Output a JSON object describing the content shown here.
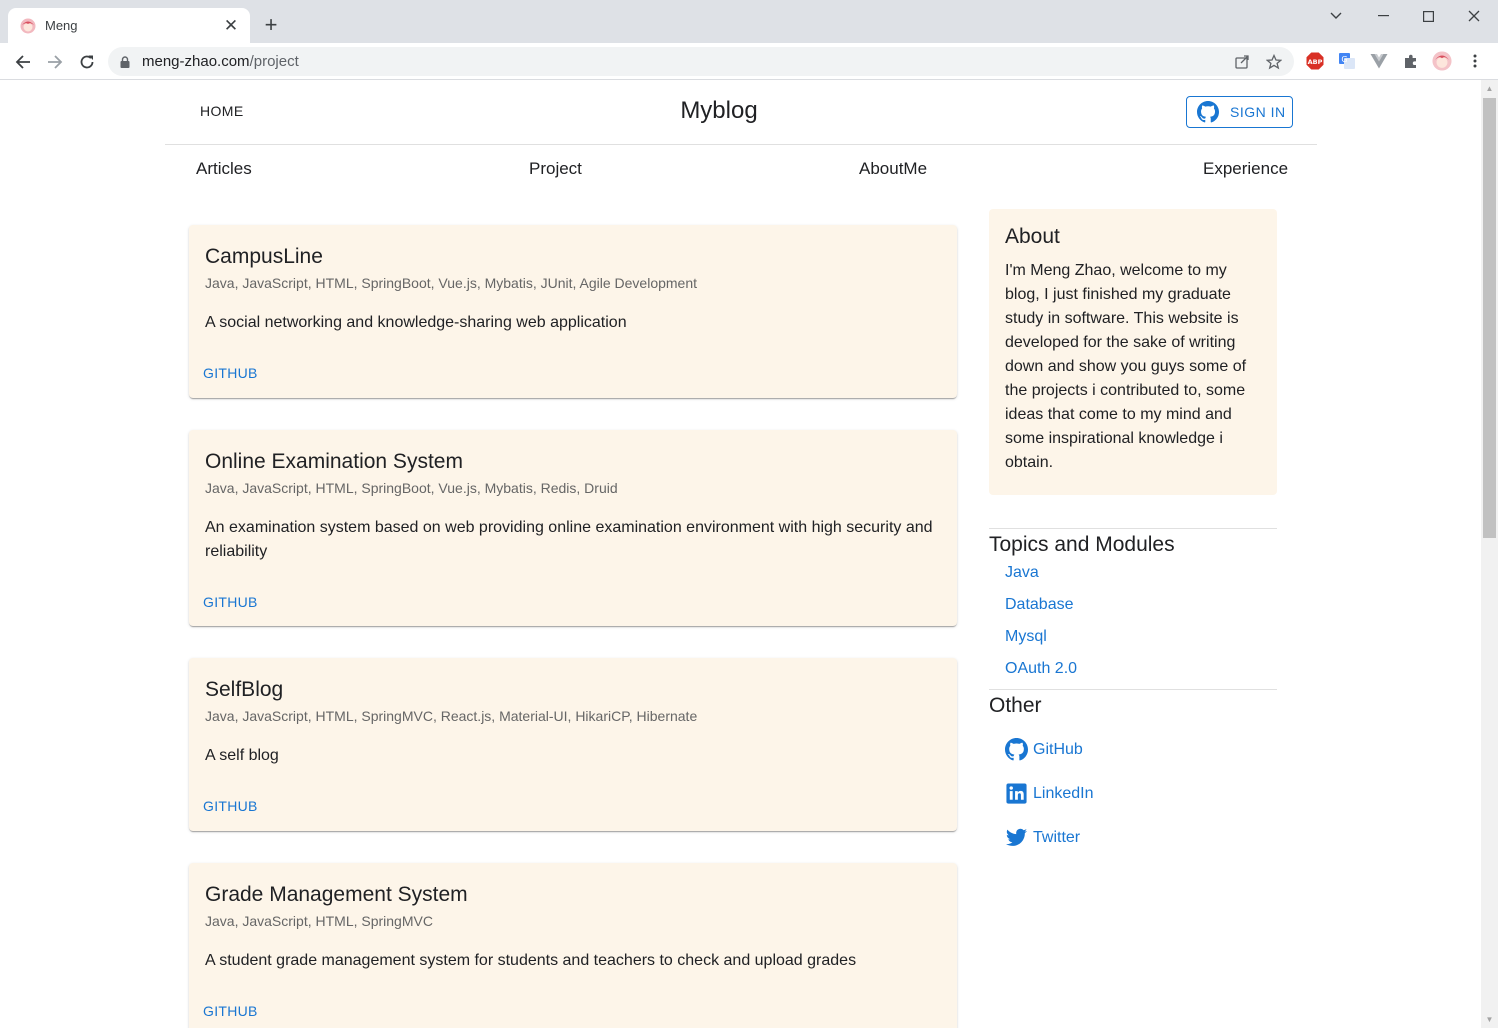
{
  "browser": {
    "tab_title": "Meng",
    "url_domain": "meng-zhao.com",
    "url_path": "/project",
    "new_tab_label": "+",
    "close_tab_label": "✕"
  },
  "site": {
    "home_label": "HOME",
    "title": "Myblog",
    "signin_label": "SIGN IN"
  },
  "nav": {
    "items": [
      "Articles",
      "Project",
      "AboutMe",
      "Experience"
    ]
  },
  "projects": [
    {
      "title": "CampusLine",
      "tags": "Java, JavaScript, HTML, SpringBoot, Vue.js, Mybatis, JUnit, Agile Development",
      "description": "A social networking and knowledge-sharing web application",
      "link": "GITHUB"
    },
    {
      "title": "Online Examination System",
      "tags": "Java, JavaScript, HTML, SpringBoot, Vue.js, Mybatis, Redis, Druid",
      "description": "An examination system based on web providing online examination environment with high security and reliability",
      "link": "GITHUB"
    },
    {
      "title": "SelfBlog",
      "tags": "Java, JavaScript, HTML, SpringMVC, React.js, Material-UI, HikariCP, Hibernate",
      "description": "A self blog",
      "link": "GITHUB"
    },
    {
      "title": "Grade Management System",
      "tags": "Java, JavaScript, HTML, SpringMVC",
      "description": "A student grade management system for students and teachers to check and upload grades",
      "link": "GITHUB"
    }
  ],
  "sidebar": {
    "about_title": "About",
    "about_body": "I'm Meng Zhao, welcome to my blog, I just finished my graduate study in software. This website is developed for the sake of writing down and show you guys some of the projects i contributed to, some ideas that come to my mind and some inspirational knowledge i obtain.",
    "topics_title": "Topics and Modules",
    "topics": [
      "Java",
      "Database",
      "Mysql",
      "OAuth 2.0"
    ],
    "other_title": "Other",
    "social": [
      "GitHub",
      "LinkedIn",
      "Twitter"
    ]
  },
  "colors": {
    "accent": "#1976d2",
    "card_bg": "#fdf5e9"
  }
}
